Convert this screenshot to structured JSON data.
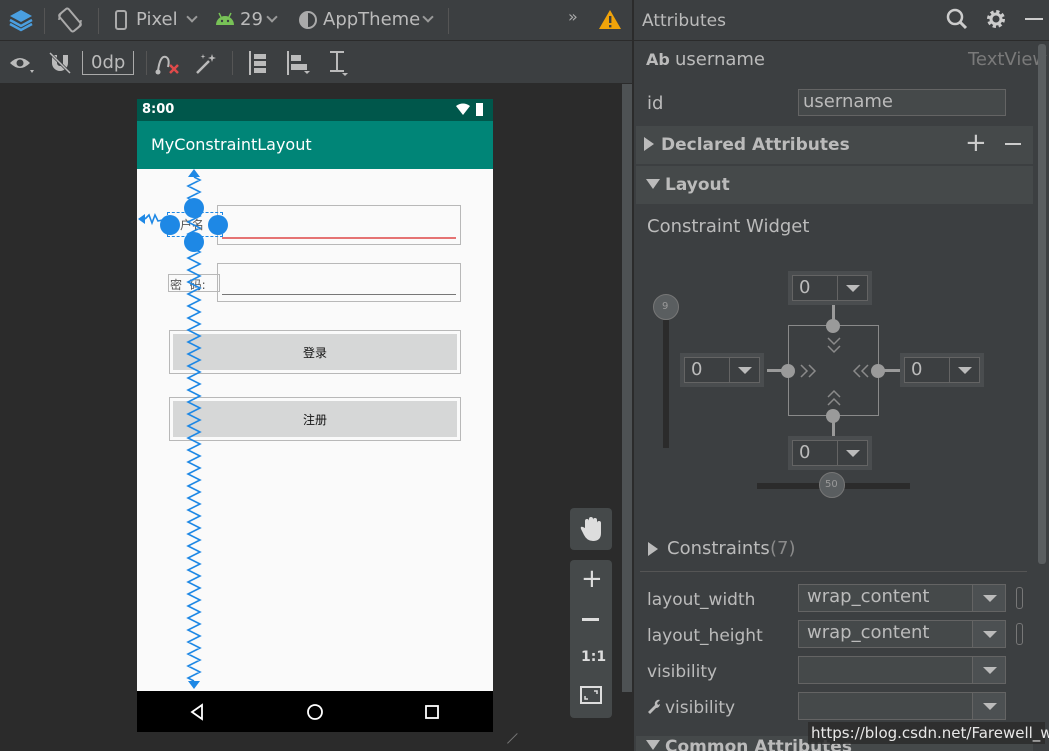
{
  "toolbar": {
    "device": "Pixel",
    "api_level": "29",
    "theme": "AppTheme",
    "margin": "0dp"
  },
  "phone": {
    "clock": "8:00",
    "app_title": "MyConstraintLayout",
    "username_label": "户名",
    "password_label": "密  码:",
    "login_button": "登录",
    "register_button": "注册"
  },
  "zoom_controls": {
    "actual_size": "1:1"
  },
  "attributes": {
    "title": "Attributes",
    "component_type_icon": "Ab",
    "component_id": "username",
    "component_class": "TextView",
    "id_label": "id",
    "id_value": "username",
    "declared_attributes": "Declared Attributes",
    "layout_section": "Layout",
    "constraint_widget": "Constraint Widget",
    "vertical_bias": "9",
    "horizontal_bias": "50",
    "margins": {
      "top": "0",
      "left": "0",
      "right": "0",
      "bottom": "0"
    },
    "constraints_label": "Constraints",
    "constraints_count": "(7)",
    "rows": [
      {
        "label": "layout_width",
        "value": "wrap_content"
      },
      {
        "label": "layout_height",
        "value": "wrap_content"
      },
      {
        "label": "visibility",
        "value": ""
      },
      {
        "label": "visibility",
        "value": ""
      }
    ],
    "common_attributes": "Common Attributes"
  },
  "watermark": "https://blog.csdn.net/Farewell_w",
  "colors": {
    "accent_blue": "#1e88e5",
    "status_bar": "#00574b",
    "app_bar": "#008577",
    "warning": "#f0a30a",
    "android_green": "#78c257"
  }
}
